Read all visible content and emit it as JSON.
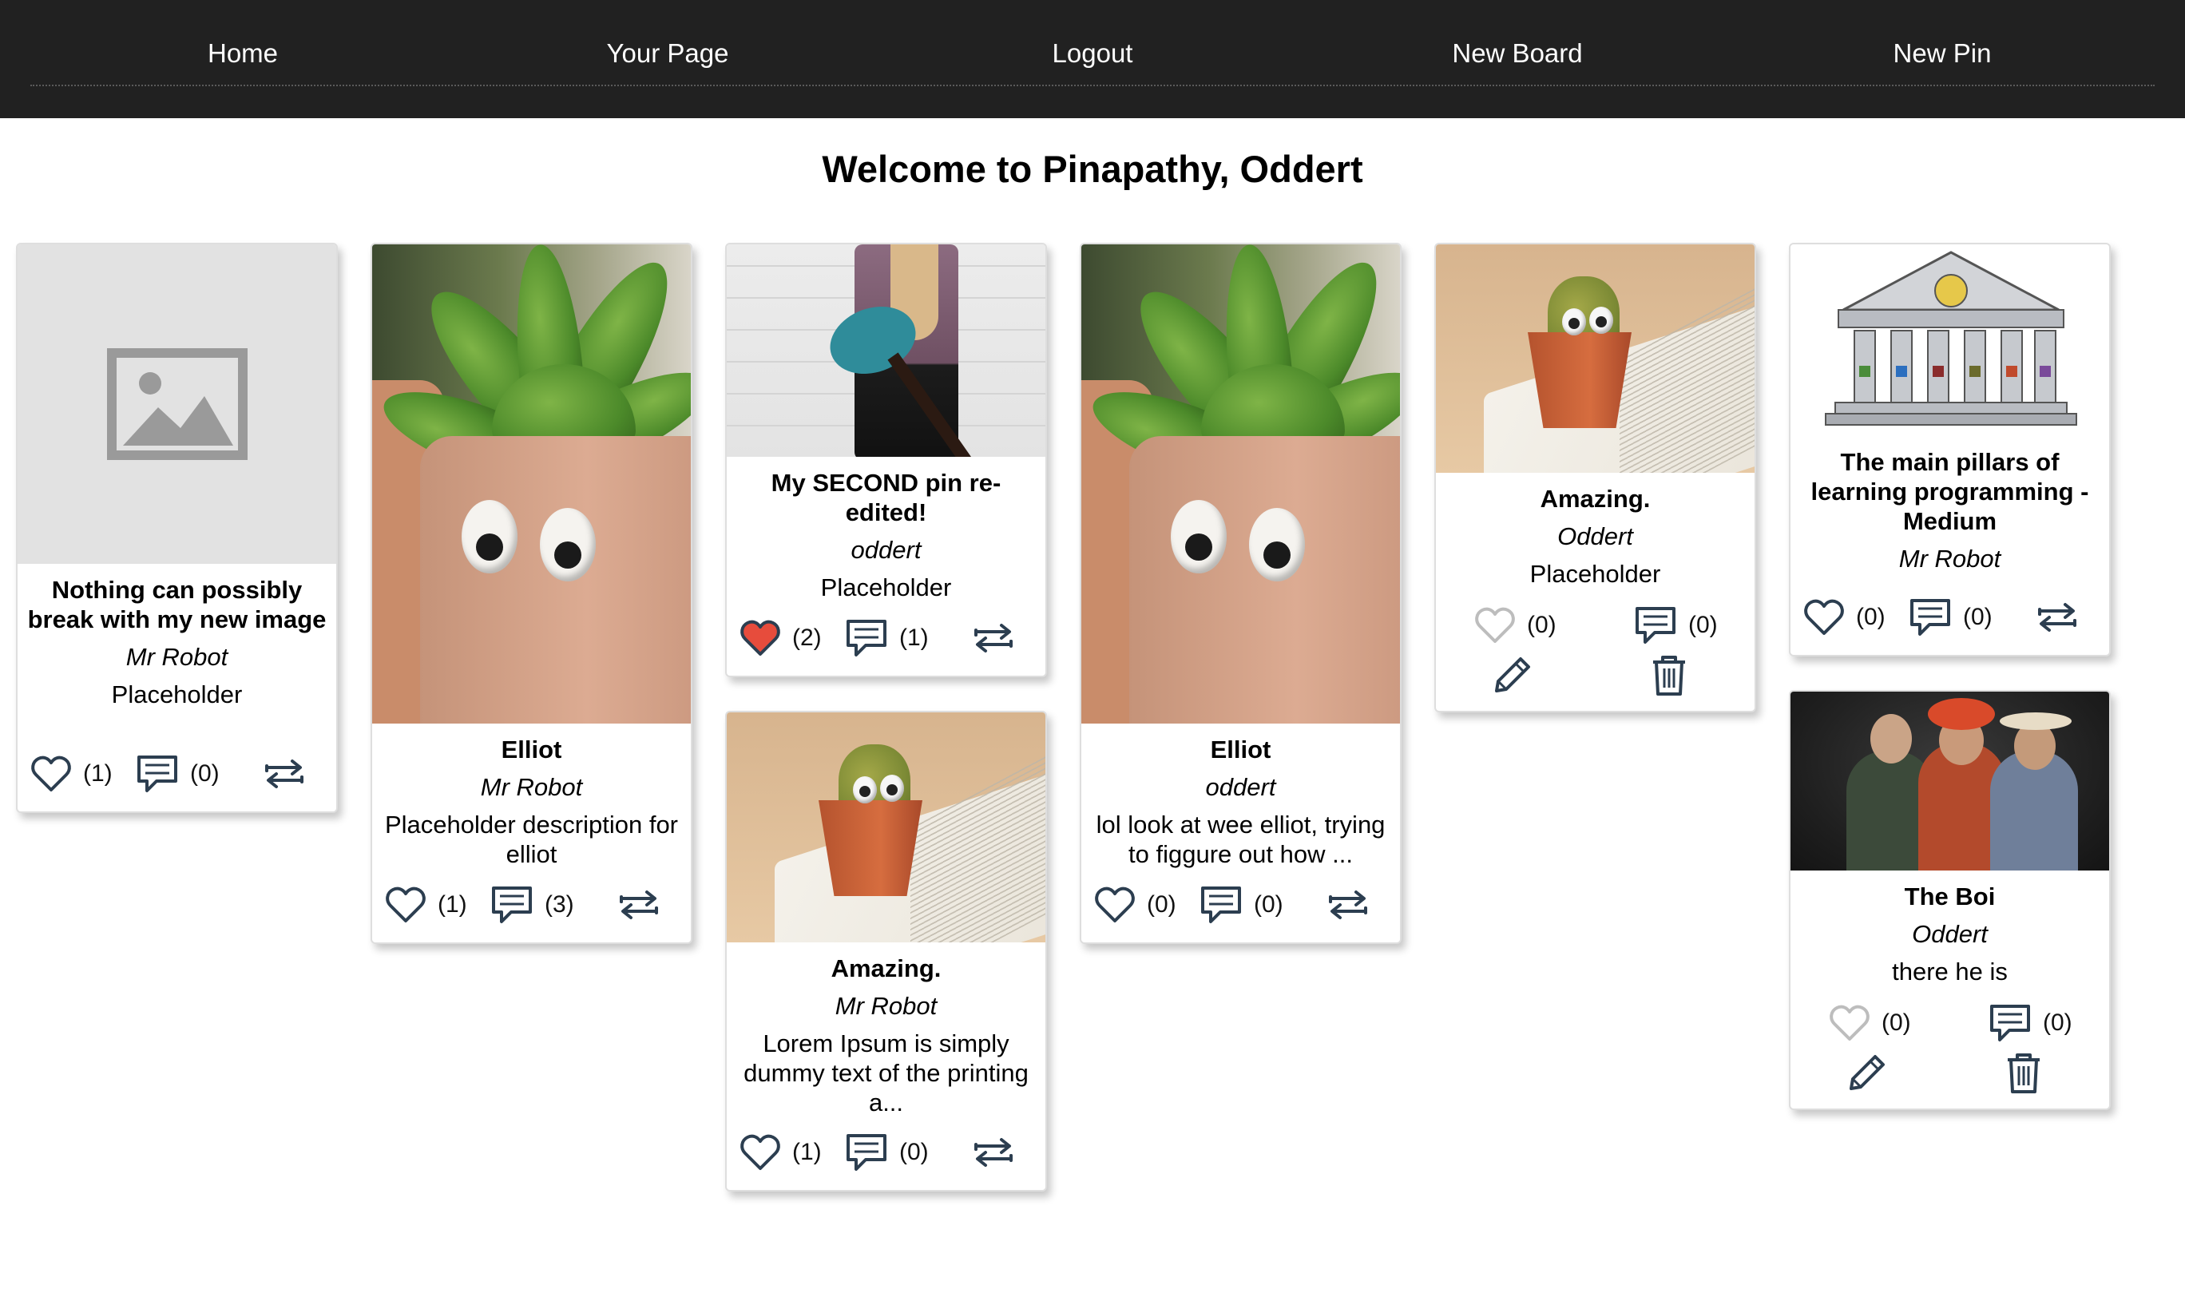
{
  "nav": {
    "home": "Home",
    "your_page": "Your Page",
    "logout": "Logout",
    "new_board": "New Board",
    "new_pin": "New Pin"
  },
  "page": {
    "title": "Welcome to Pinapathy, Oddert"
  },
  "colors": {
    "nav_bg": "#212121",
    "liked": "#e74c3c",
    "icon": "#2c3e50",
    "icon_owner": "#bdbdbd"
  },
  "pins": [
    {
      "title": "Nothing can possibly break with my new image",
      "author": "Mr Robot",
      "description": "Placeholder",
      "likes": "(1)",
      "comments": "(0)",
      "image": "image-placeholder-icon"
    },
    {
      "title": "Elliot",
      "author": "Mr Robot",
      "description": "Placeholder description for elliot",
      "likes": "(1)",
      "comments": "(3)",
      "image": "succulent-googly-eyes-photo"
    },
    {
      "title": "My SECOND pin re-edited!",
      "author": "oddert",
      "description": "Placeholder",
      "likes": "(2)",
      "comments": "(1)",
      "image": "guitar-photo",
      "liked": true
    },
    {
      "title": "Amazing.",
      "author": "Mr Robot",
      "description": "Lorem Ipsum is simply dummy text of the printing a...",
      "likes": "(1)",
      "comments": "(0)",
      "image": "cactus-book-photo"
    },
    {
      "title": "Elliot",
      "author": "oddert",
      "description": "lol look at wee elliot, trying to figgure out how ...",
      "likes": "(0)",
      "comments": "(0)",
      "image": "succulent-googly-eyes-photo"
    },
    {
      "title": "Amazing.",
      "author": "Oddert",
      "description": "Placeholder",
      "likes": "(0)",
      "comments": "(0)",
      "image": "cactus-book-photo",
      "owner": true
    },
    {
      "title": "The main pillars of learning programming - Medium",
      "author": "Mr Robot",
      "description": "",
      "likes": "(0)",
      "comments": "(0)",
      "image": "temple-pillars-illustration"
    },
    {
      "title": "The Boi",
      "author": "Oddert",
      "description": "there he is",
      "likes": "(0)",
      "comments": "(0)",
      "image": "three-men-photo",
      "owner": true
    }
  ]
}
